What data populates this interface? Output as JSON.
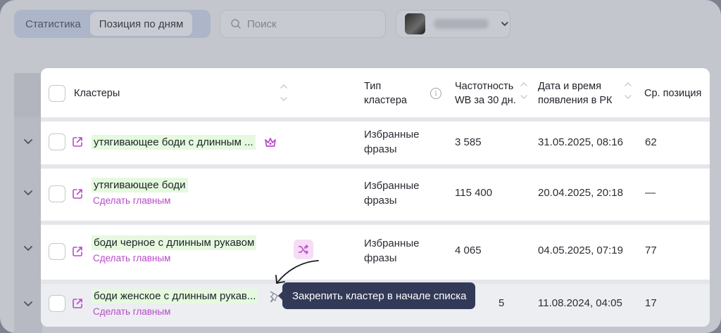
{
  "tabs": [
    {
      "label": "Статистика",
      "active": false
    },
    {
      "label": "Позиция по дням",
      "active": true
    }
  ],
  "search": {
    "placeholder": "Поиск",
    "icon": "search-icon"
  },
  "account": {
    "icon": "chevron-down-icon"
  },
  "table": {
    "headers": {
      "clusters": "Кластеры",
      "type_line1": "Тип",
      "type_line2": "кластера",
      "freq_line1": "Частотность",
      "freq_line2": "WB за 30 дн.",
      "date_line1": "Дата и время",
      "date_line2": "появления в РК",
      "position": "Ср. позиция"
    },
    "rows": [
      {
        "phrase": "утягивающее боди с длинным ...",
        "action": "",
        "type_line1": "Избранные",
        "type_line2": "фразы",
        "frequency": "3 585",
        "datetime": "31.05.2025, 08:16",
        "position": "62",
        "badge": "crown-icon"
      },
      {
        "phrase": "утягивающее боди",
        "action": "Сделать главным",
        "type_line1": "Избранные",
        "type_line2": "фразы",
        "frequency": "115 400",
        "datetime": "20.04.2025, 20:18",
        "position": "—"
      },
      {
        "phrase": "боди черное с длинным рукавом",
        "action": "Сделать главным",
        "type_line1": "Избранные",
        "type_line2": "фразы",
        "frequency": "4 065",
        "datetime": "04.05.2025, 07:19",
        "position": "77",
        "badge": "shuffle-icon"
      },
      {
        "phrase": "боди женское с длинным рукав...",
        "action": "Сделать главным",
        "type_line1": "",
        "type_line2": "",
        "frequency": "5",
        "datetime": "11.08.2024, 04:05",
        "position": "17",
        "badge": "pin-icon"
      }
    ]
  },
  "tooltip": {
    "text": "Закрепить кластер в начале списка"
  },
  "colors": {
    "accent": "#b74ac7",
    "highlight": "#e5f9df",
    "tooltip_bg": "#323a58"
  }
}
